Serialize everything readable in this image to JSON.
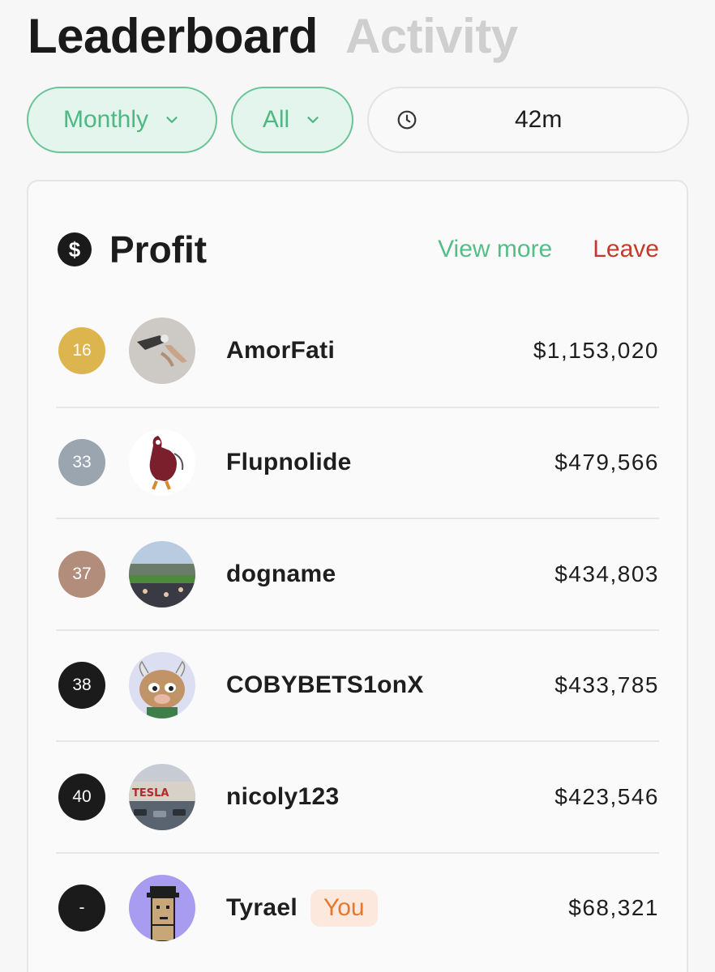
{
  "tabs": {
    "leaderboard": "Leaderboard",
    "activity": "Activity"
  },
  "filters": {
    "period": "Monthly",
    "scope": "All",
    "timer": "42m"
  },
  "card": {
    "title": "Profit",
    "view_more": "View more",
    "leave": "Leave"
  },
  "icons": {
    "currency": "dollar-circle-icon",
    "timer": "clock-icon",
    "dropdown": "chevron-down-icon"
  },
  "colors": {
    "accent_green": "#4db882",
    "leave_red": "#c23a2e",
    "you_badge": "#e8772e",
    "rank_gold": "#dcb54f",
    "rank_silver": "#9aa5b0",
    "rank_bronze": "#b38d7b",
    "rank_default": "#1b1b1b"
  },
  "rows": [
    {
      "rank": "16",
      "name": "AmorFati",
      "amount": "$1,153,020",
      "badge": ""
    },
    {
      "rank": "33",
      "name": "Flupnolide",
      "amount": "$479,566",
      "badge": ""
    },
    {
      "rank": "37",
      "name": "dogname",
      "amount": "$434,803",
      "badge": ""
    },
    {
      "rank": "38",
      "name": "COBYBETS1onX",
      "amount": "$433,785",
      "badge": ""
    },
    {
      "rank": "40",
      "name": "nicoly123",
      "amount": "$423,546",
      "badge": ""
    },
    {
      "rank": "-",
      "name": "Tyrael",
      "amount": "$68,321",
      "badge": "You"
    }
  ]
}
